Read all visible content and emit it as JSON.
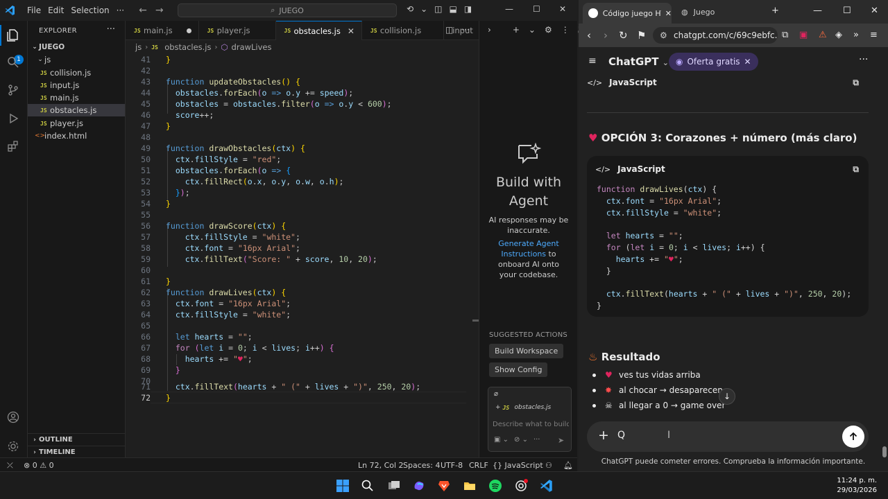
{
  "vscode": {
    "menu": [
      "File",
      "Edit",
      "Selection"
    ],
    "search": "JUEGO",
    "explorer_title": "EXPLORER",
    "root_folder": "JUEGO",
    "folder_js": "js",
    "files": [
      "collision.js",
      "input.js",
      "main.js",
      "obstacles.js",
      "player.js"
    ],
    "index_file": "index.html",
    "outline": "OUTLINE",
    "timeline": "TIMELINE",
    "tabs": [
      "main.js",
      "player.js",
      "obstacles.js",
      "collision.js",
      "input"
    ],
    "breadcrumb": [
      "js",
      "obstacles.js",
      "drawLives"
    ],
    "badge_count": "1",
    "line_numbers": [
      "41",
      "42",
      "43",
      "44",
      "45",
      "46",
      "47",
      "48",
      "49",
      "50",
      "51",
      "52",
      "53",
      "54",
      "55",
      "56",
      "57",
      "58",
      "59",
      "60",
      "61",
      "62",
      "63",
      "64",
      "65",
      "66",
      "67",
      "68",
      "69",
      "70",
      "71",
      "72"
    ],
    "agent": {
      "title": "Build with Agent",
      "subtitle": "AI responses may be inaccurate.",
      "link": "Generate Agent Instructions",
      "link_suffix": " to onboard AI onto your codebase.",
      "suggested_title": "SUGGESTED ACTIONS",
      "actions": [
        "Build Workspace",
        "Show Config"
      ],
      "context_file": "obstacles.js",
      "placeholder": "Describe what to build"
    },
    "status": {
      "errors": "0",
      "warnings": "0",
      "position": "Ln 72, Col 2",
      "spaces": "Spaces: 4",
      "encoding": "UTF-8",
      "eol": "CRLF",
      "language": "JavaScript"
    }
  },
  "browser": {
    "tab_active": "Código juego HTML",
    "tab_other": "Juego",
    "url": "chatgpt.com/c/69c9ebfc...",
    "app_name": "ChatGPT",
    "offer": "Oferta gratis",
    "prev_block_lang": "JavaScript",
    "option_heading": "OPCIÓN 3: Corazones + número (más claro)",
    "block_lang": "JavaScript",
    "result_heading": "Resultado",
    "bullets": [
      "ves tus vidas arriba",
      "al chocar → desaparecen",
      "al llegar a 0 → game over"
    ],
    "composer_text": "Q",
    "disclaimer": "ChatGPT puede cometer errores. Comprueba la información importante."
  },
  "taskbar": {
    "time": "11:24 p. m.",
    "date": "29/03/2026"
  },
  "colors": {
    "accent": "#0078d4",
    "js_badge": "#cbcb41",
    "offer_bg": "#3a2f5c"
  }
}
